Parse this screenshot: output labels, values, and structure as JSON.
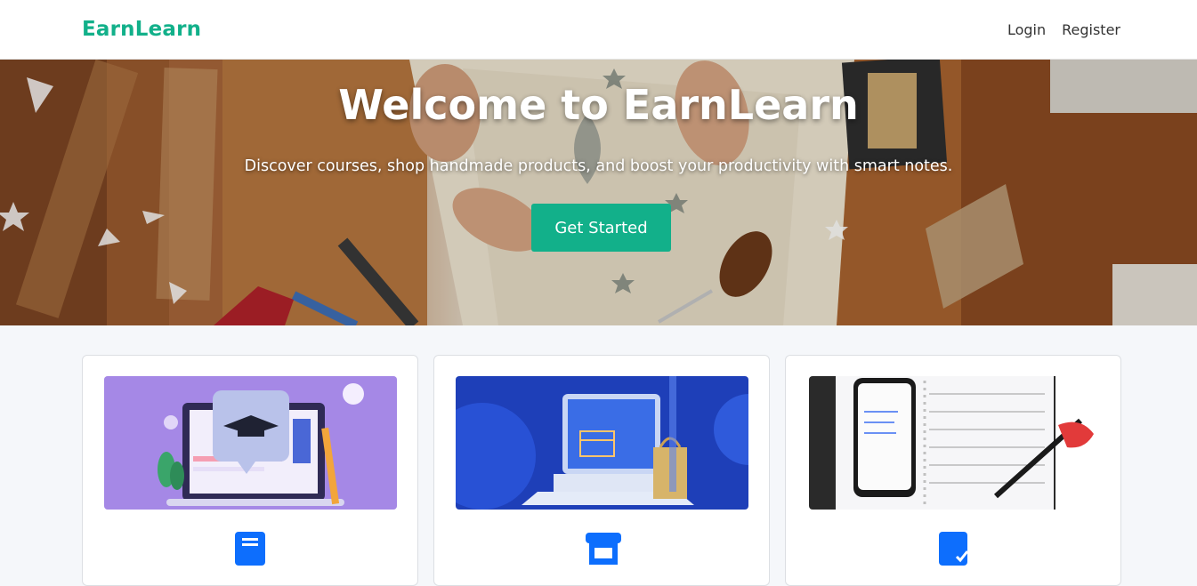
{
  "navbar": {
    "brand": "EarnLearn",
    "links": {
      "login": "Login",
      "register": "Register"
    }
  },
  "hero": {
    "title": "Welcome to EarnLearn",
    "subtitle": "Discover courses, shop handmade products, and boost your productivity with smart notes.",
    "cta_label": "Get Started"
  },
  "cards": [
    {
      "image": "online-learning-illustration",
      "icon": "book-icon"
    },
    {
      "image": "online-shop-illustration",
      "icon": "store-icon"
    },
    {
      "image": "smart-notes-illustration",
      "icon": "note-check-icon"
    }
  ],
  "colors": {
    "brand": "#12b08a",
    "icon_blue": "#0d6efd"
  }
}
